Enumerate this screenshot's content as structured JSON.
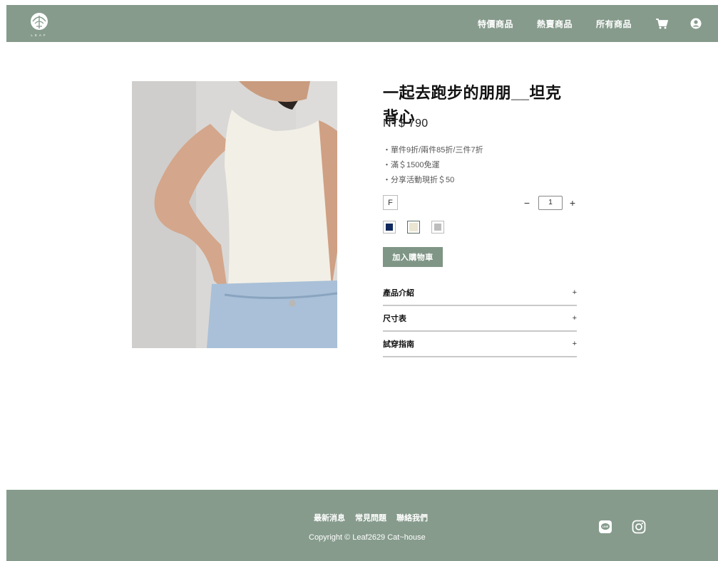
{
  "header": {
    "logo_text": "LEAF",
    "nav": [
      "特價商品",
      "熱賣商品",
      "所有商品"
    ],
    "cart_icon": "cart-icon",
    "account_icon": "user-circle-icon",
    "brand_color": "#869b8c"
  },
  "product": {
    "title": "一起去跑步的朋朋__坦克背心",
    "price": "NT$ 790",
    "notes": [
      "・單件9折/兩件85折/三件7折",
      "・滿＄1500免運",
      "・分享活動現折＄50"
    ],
    "size_option": "F",
    "quantity": "1",
    "qty_minus": "−",
    "qty_plus": "+",
    "colors": [
      {
        "name": "navy",
        "hex": "#102a5e",
        "selected": false
      },
      {
        "name": "cream",
        "hex": "#eae6d2",
        "selected": true
      },
      {
        "name": "gray",
        "hex": "#bdbdbd",
        "selected": false
      }
    ],
    "add_to_cart": "加入購物車",
    "accordion": [
      {
        "label": "產品介紹",
        "toggle": "+"
      },
      {
        "label": "尺寸表",
        "toggle": "+"
      },
      {
        "label": "試穿指南",
        "toggle": "+"
      }
    ]
  },
  "footer": {
    "links": [
      "最新消息",
      "常見問題",
      "聯絡我們"
    ],
    "copyright": "Copyright © Leaf2629 Cat~house",
    "social_icons": [
      "line-icon",
      "instagram-icon"
    ]
  }
}
